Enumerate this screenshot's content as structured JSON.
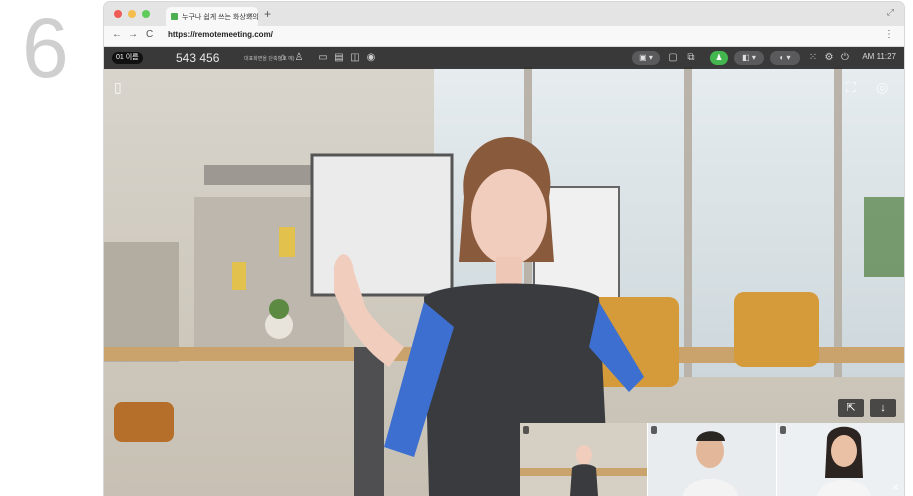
{
  "step": {
    "number": "6"
  },
  "browser": {
    "tab_title": "누구나 쉽게 쓰는 화상회의",
    "tab_close": "×",
    "new_tab": "+",
    "url": "https://remotemeeting.com/",
    "nav": {
      "back": "←",
      "forward": "→",
      "reload": "C"
    },
    "menu": "⋮",
    "collapse": "⤢"
  },
  "meeting": {
    "room_badge": "01 이름",
    "room_number": "543 456",
    "room_subtitle": "대표화면을 단축번호 예)",
    "clock": "AM 11:27",
    "actions": {
      "share": "⇱",
      "download": "↓"
    },
    "participants": [
      {
        "label": "",
        "kind": "avatar"
      },
      {
        "label": "",
        "kind": "man"
      },
      {
        "label": "",
        "kind": "woman"
      }
    ]
  },
  "colors": {
    "accent_green": "#43b64f",
    "toolbar_bg": "#2a2a2c"
  }
}
